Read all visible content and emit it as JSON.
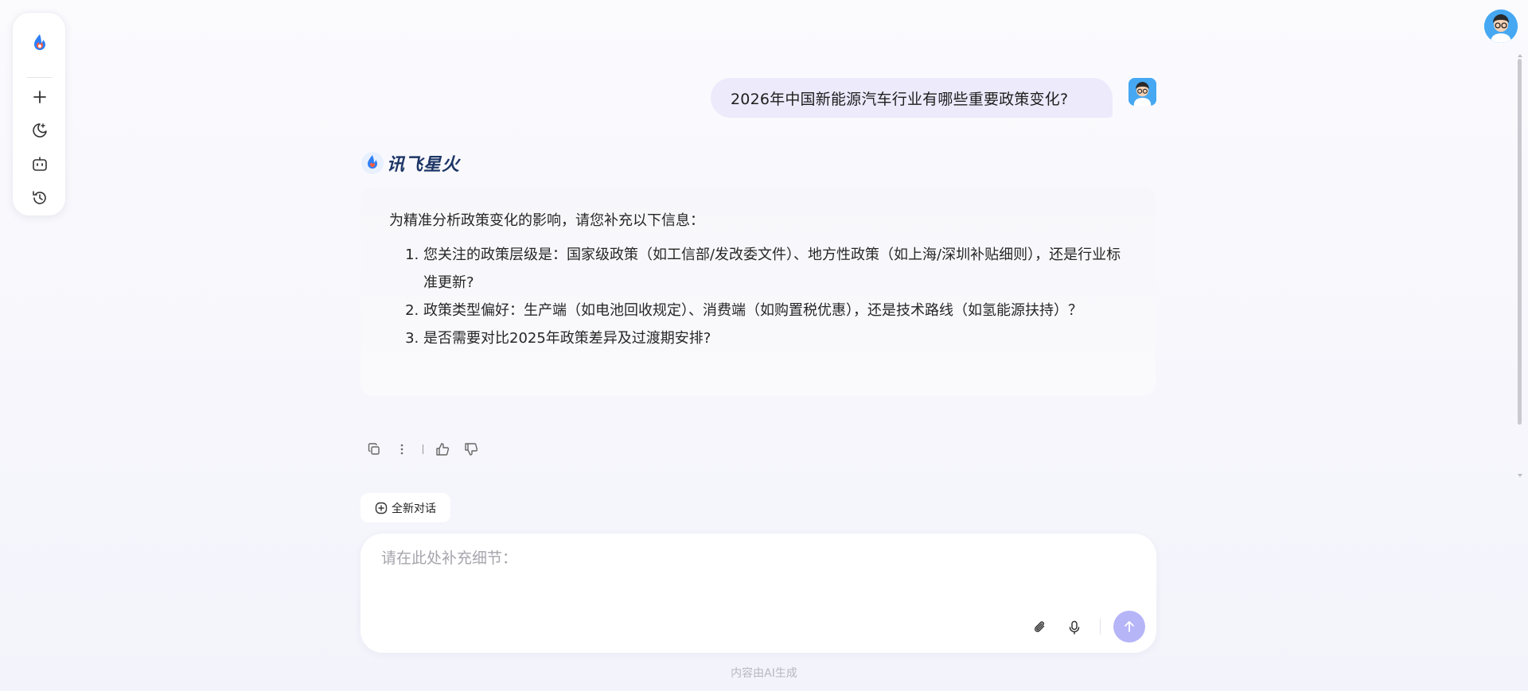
{
  "sidebar": {
    "logo_icon": "spark-flame-icon",
    "items": [
      {
        "icon": "plus-icon",
        "name": "new"
      },
      {
        "icon": "moon-sparkle-icon",
        "name": "discover"
      },
      {
        "icon": "robot-icon",
        "name": "agents"
      },
      {
        "icon": "history-icon",
        "name": "history"
      }
    ]
  },
  "conversation": {
    "user_message": "2026年中国新能源汽车行业有哪些重要政策变化?",
    "brand_name": "讯飞星火",
    "answer": {
      "intro": "为精准分析政策变化的影响，请您补充以下信息：",
      "items": [
        "您关注的政策层级是：国家级政策（如工信部/发改委文件）、地方性政策（如上海/深圳补贴细则），还是行业标准更新?",
        "政策类型偏好：生产端（如电池回收规定）、消费端（如购置税优惠），还是技术路线（如氢能源扶持）？",
        "是否需要对比2025年政策差异及过渡期安排?"
      ]
    }
  },
  "actions": {
    "icons": [
      "copy-icon",
      "more-icon",
      "thumbs-up-icon",
      "thumbs-down-icon"
    ]
  },
  "new_chat": {
    "label": "全新对话"
  },
  "composer": {
    "placeholder": "请在此处补充细节：",
    "value": ""
  },
  "footer": {
    "note": "内容由AI生成"
  },
  "colors": {
    "accent": "#b6b5f8",
    "user_bubble": "#eceafb",
    "brand_text": "#1d3566"
  }
}
